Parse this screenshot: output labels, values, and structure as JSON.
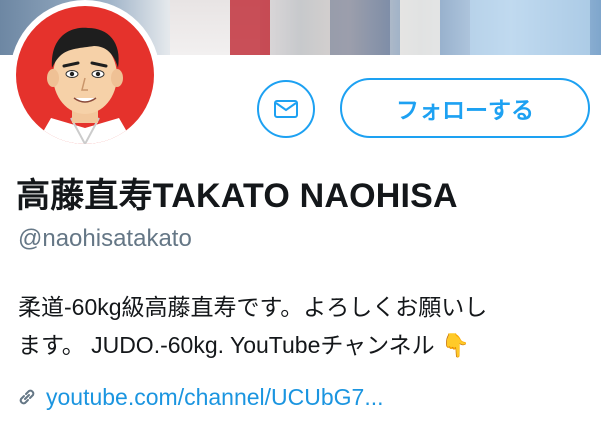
{
  "profile": {
    "display_name": "高藤直寿TAKATO NAOHISA",
    "handle": "@naohisatakato",
    "bio_line1": "柔道-60kg級高藤直寿です。よろしくお願いし",
    "bio_line2_text": "ます。 JUDO.-60kg. YouTubeチャンネル ",
    "bio_emoji": "👇",
    "link_text": "youtube.com/channel/UCUbG7...",
    "avatar_name": "cartoon-avatar"
  },
  "actions": {
    "follow_label": "フォローする",
    "message_icon": "envelope-icon"
  },
  "colors": {
    "accent": "#1da1f2",
    "link": "#1b95e0",
    "secondary_text": "#657786",
    "avatar_bg": "#e5322c"
  }
}
